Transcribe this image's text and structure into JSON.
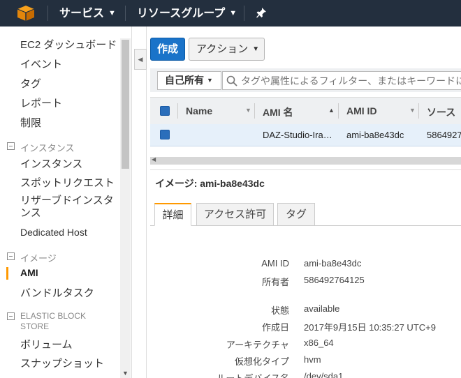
{
  "topnav": {
    "services_label": "サービス",
    "resource_groups_label": "リソースグループ"
  },
  "sidebar": {
    "top_items": [
      "EC2 ダッシュボード",
      "イベント",
      "タグ",
      "レポート",
      "制限"
    ],
    "sections": [
      {
        "title": "インスタンス",
        "items": [
          "インスタンス",
          "スポットリクエスト",
          "リザーブドインスタンス",
          "Dedicated Host"
        ]
      },
      {
        "title": "イメージ",
        "items": [
          "AMI",
          "バンドルタスク"
        ]
      },
      {
        "title": "ELASTIC BLOCK STORE",
        "items": [
          "ボリューム",
          "スナップショット"
        ]
      }
    ],
    "active_item": "AMI"
  },
  "toolbar": {
    "create_label": "作成",
    "actions_label": "アクション"
  },
  "filter": {
    "owner_label": "自己所有",
    "search_placeholder": "タグや属性によるフィルター、またはキーワードによ"
  },
  "grid": {
    "columns": [
      "Name",
      "AMI 名",
      "AMI ID",
      "ソース"
    ],
    "rows": [
      {
        "name": "",
        "ami_name": "DAZ-Studio-Ira…",
        "ami_id": "ami-ba8e43dc",
        "source": "5864927"
      }
    ]
  },
  "detail": {
    "title": "イメージ: ami-ba8e43dc",
    "tabs": [
      "詳細",
      "アクセス許可",
      "タグ"
    ],
    "fields": [
      {
        "label": "AMI ID",
        "value": "ami-ba8e43dc"
      },
      {
        "label": "所有者",
        "value": "586492764125"
      },
      {
        "label": "状態",
        "value": "available"
      },
      {
        "label": "作成日",
        "value": "2017年9月15日 10:35:27 UTC+9"
      },
      {
        "label": "アーキテクチャ",
        "value": "x86_64"
      },
      {
        "label": "仮想化タイプ",
        "value": "hvm"
      },
      {
        "label": "ルートデバイス名",
        "value": "/dev/sda1"
      }
    ]
  },
  "colors": {
    "nav_bg": "#232f3e",
    "primary_button": "#1a73c9",
    "accent_orange": "#ff9900",
    "selected_row": "#e6f0fa"
  }
}
